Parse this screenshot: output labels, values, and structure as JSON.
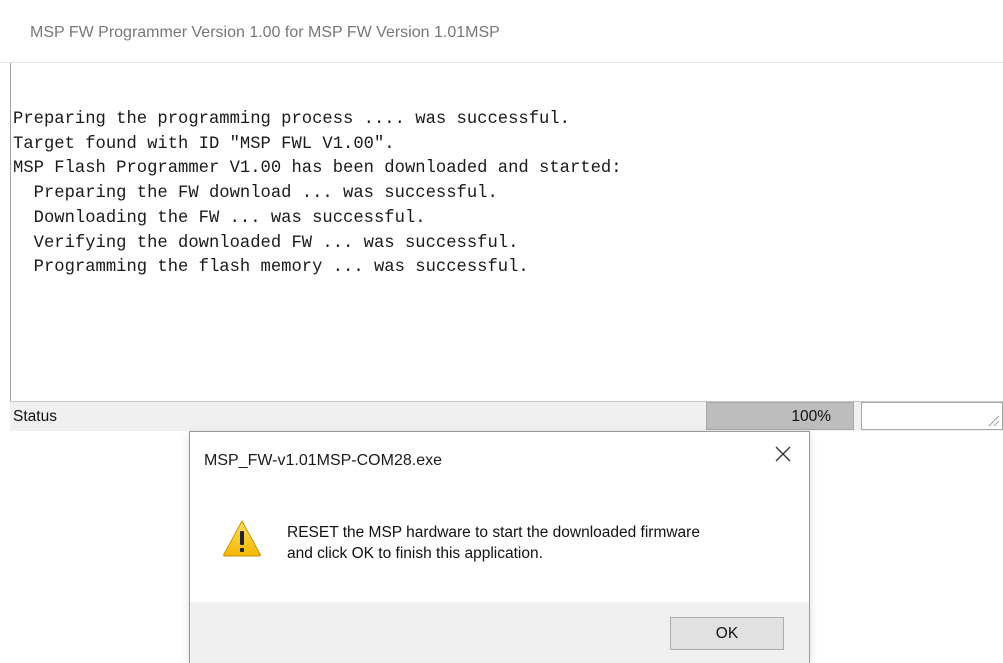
{
  "main_window": {
    "title": "MSP FW Programmer Version 1.00 for MSP FW Version 1.01MSP",
    "log": [
      "Preparing the programming process .... was successful.",
      "Target found with ID \"MSP FWL V1.00\".",
      "MSP Flash Programmer V1.00 has been downloaded and started:",
      "  Preparing the FW download ... was successful.",
      "  Downloading the FW ... was successful.",
      "  Verifying the downloaded FW ... was successful.",
      "  Programming the flash memory ... was successful."
    ]
  },
  "status_bar": {
    "label": "Status",
    "progress_text": "100%",
    "progress_fraction": 1.0
  },
  "dialog": {
    "title": "MSP_FW-v1.01MSP-COM28.exe",
    "close_icon": "close-icon",
    "icon": "warning-icon",
    "message_line1": "RESET the MSP hardware to start the downloaded firmware",
    "message_line2": "and click OK to finish this application.",
    "ok_label": "OK"
  },
  "colors": {
    "progress_fill": "#bdbdbd",
    "warning_yellow": "#f7c400",
    "dialog_footer": "#f0f0f0"
  }
}
